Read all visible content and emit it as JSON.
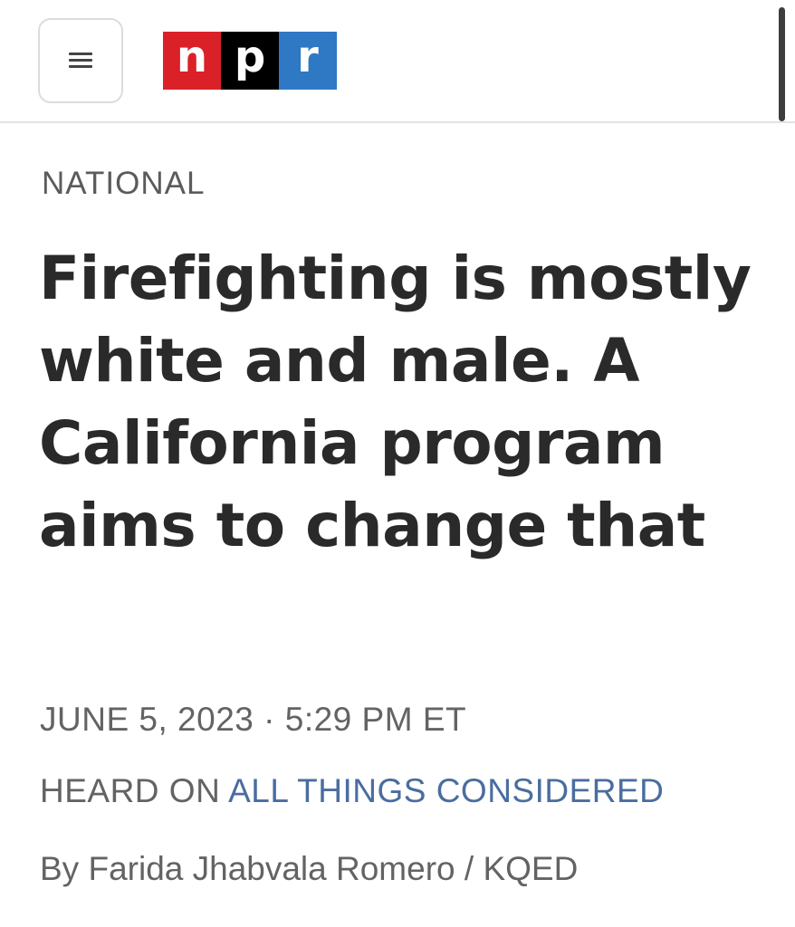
{
  "header": {
    "logo": {
      "letters": [
        "n",
        "p",
        "r"
      ],
      "colors": [
        "#da2128",
        "#000000",
        "#2f78c4"
      ]
    }
  },
  "article": {
    "section": "NATIONAL",
    "headline": "Firefighting is mostly white and male. A California program aims to change that",
    "date": "JUNE 5, 2023",
    "separator": "·",
    "time": "5:29 PM ET",
    "heard_on_prefix": "HEARD ON",
    "show_name": "ALL THINGS CONSIDERED",
    "byline_prefix": "By",
    "author": "Farida Jhabvala Romero",
    "byline_divider": "/",
    "affiliate": "KQED"
  },
  "colors": {
    "link": "#4a6da0",
    "text_muted": "#636363",
    "headline": "#2a2a2a"
  }
}
